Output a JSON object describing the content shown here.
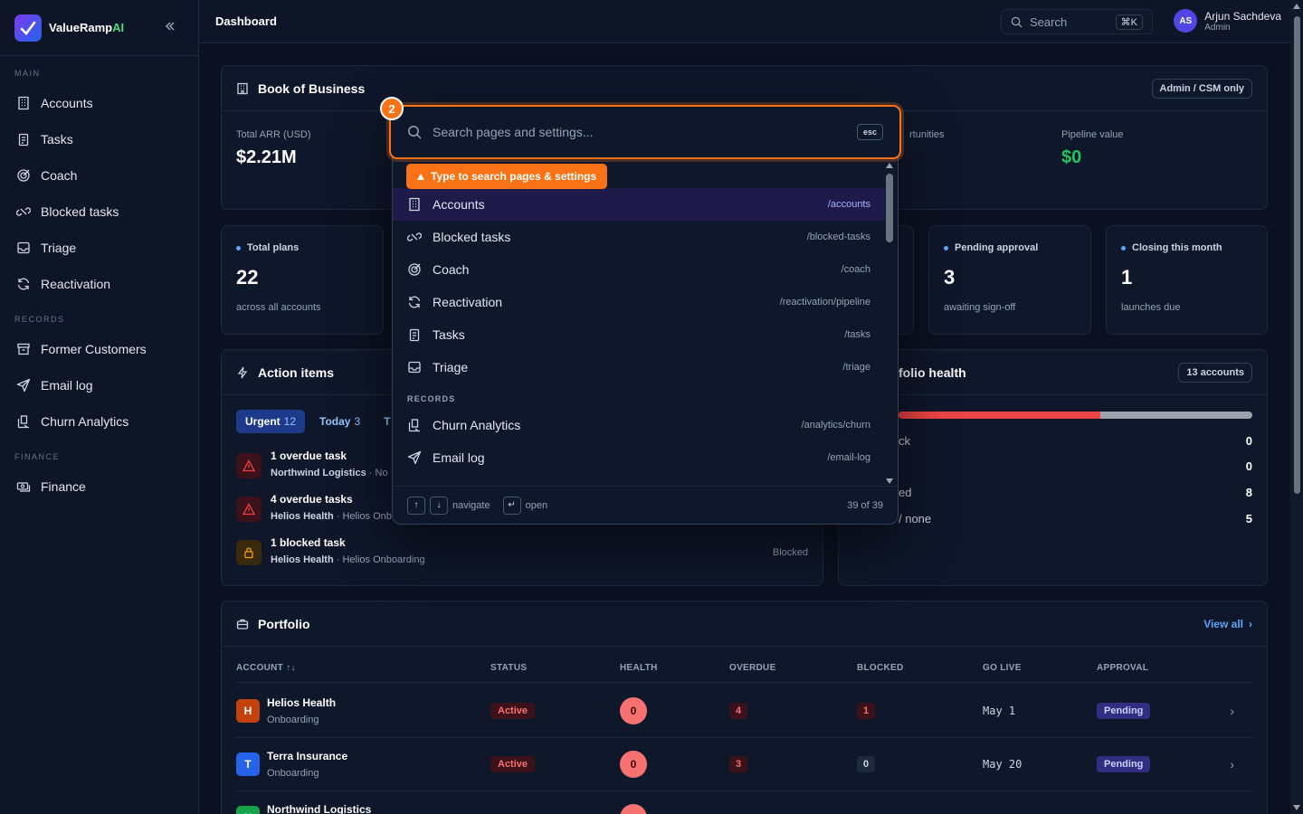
{
  "brand": {
    "name_main": "ValueRamp",
    "name_accent": "AI"
  },
  "sidebar": {
    "sections": [
      {
        "label": "MAIN",
        "items": [
          {
            "label": "Accounts",
            "icon": "building-icon"
          },
          {
            "label": "Tasks",
            "icon": "clipboard-icon"
          },
          {
            "label": "Coach",
            "icon": "target-icon"
          },
          {
            "label": "Blocked tasks",
            "icon": "link-broken-icon"
          },
          {
            "label": "Triage",
            "icon": "inbox-icon"
          },
          {
            "label": "Reactivation",
            "icon": "refresh-icon"
          }
        ]
      },
      {
        "label": "RECORDS",
        "items": [
          {
            "label": "Former Customers",
            "icon": "archive-icon"
          },
          {
            "label": "Email log",
            "icon": "send-icon"
          },
          {
            "label": "Churn Analytics",
            "icon": "chart-icon"
          }
        ]
      },
      {
        "label": "FINANCE",
        "items": [
          {
            "label": "Finance",
            "icon": "money-icon"
          }
        ]
      }
    ]
  },
  "header": {
    "title": "Dashboard",
    "search_label": "Search",
    "search_kbd": "⌘K",
    "user": {
      "initials": "AS",
      "name": "Arjun Sachdeva",
      "role": "Admin"
    }
  },
  "book": {
    "title": "Book of Business",
    "badge": "Admin / CSM only",
    "metrics": [
      {
        "label": "Total ARR (USD)",
        "value": "$2.21M"
      },
      {
        "label": "rtunities",
        "value": ""
      },
      {
        "label": "Pipeline value",
        "value": "$0"
      }
    ]
  },
  "stats": [
    {
      "label": "Total plans",
      "value": "22",
      "sub": "across all accounts"
    },
    {
      "label": "Pending approval",
      "value": "3",
      "sub": "awaiting sign-off"
    },
    {
      "label": "Closing this month",
      "value": "1",
      "sub": "launches due"
    }
  ],
  "actions": {
    "title": "Action items",
    "tabs": [
      {
        "label": "Urgent",
        "count": "12"
      },
      {
        "label": "Today",
        "count": "3"
      },
      {
        "label": "T",
        "count": ""
      }
    ],
    "items": [
      {
        "title": "1 overdue task",
        "account": "Northwind Logistics",
        "rest": " · No",
        "status": ""
      },
      {
        "title": "4 overdue tasks",
        "account": "Helios Health",
        "rest": " · Helios Onb",
        "status": ""
      },
      {
        "title": "1 blocked task",
        "account": "Helios Health",
        "rest": " · Helios Onboarding",
        "status": "Blocked"
      }
    ]
  },
  "health": {
    "title": "folio health",
    "badge": "13 accounts",
    "red_fraction": 0.57,
    "rows": [
      {
        "label": "ck",
        "value": "0"
      },
      {
        "label": "",
        "value": "0"
      },
      {
        "label": "ed",
        "value": "8"
      },
      {
        "label": "/ none",
        "value": "5"
      }
    ]
  },
  "portfolio": {
    "title": "Portfolio",
    "view_all": "View all",
    "columns": [
      "ACCOUNT",
      "STATUS",
      "HEALTH",
      "OVERDUE",
      "BLOCKED",
      "GO LIVE",
      "APPROVAL"
    ],
    "sort_icon": "↑↓",
    "rows": [
      {
        "initial": "H",
        "color": "#c2410c",
        "name": "Helios Health",
        "stage": "Onboarding",
        "status": "Active",
        "health": "0",
        "overdue": "4",
        "blocked": "1",
        "golive": "May 1",
        "approval": "Pending"
      },
      {
        "initial": "T",
        "color": "#2563eb",
        "name": "Terra Insurance",
        "stage": "Onboarding",
        "status": "Active",
        "health": "0",
        "overdue": "3",
        "blocked": "0",
        "golive": "May 20",
        "approval": "Pending"
      },
      {
        "initial": "N",
        "color": "#16a34a",
        "name": "Northwind Logistics",
        "stage": "",
        "status": "",
        "health": "",
        "overdue": "",
        "blocked": "",
        "golive": "",
        "approval": ""
      }
    ]
  },
  "palette": {
    "marker": "2",
    "placeholder": "Search pages and settings...",
    "esc": "esc",
    "hint": "Type to search pages & settings",
    "items": [
      {
        "label": "Accounts",
        "path": "/accounts",
        "icon": "building-icon"
      },
      {
        "label": "Blocked tasks",
        "path": "/blocked-tasks",
        "icon": "link-broken-icon"
      },
      {
        "label": "Coach",
        "path": "/coach",
        "icon": "target-icon"
      },
      {
        "label": "Reactivation",
        "path": "/reactivation/pipeline",
        "icon": "refresh-icon"
      },
      {
        "label": "Tasks",
        "path": "/tasks",
        "icon": "clipboard-icon"
      },
      {
        "label": "Triage",
        "path": "/triage",
        "icon": "inbox-icon"
      }
    ],
    "section_records": "RECORDS",
    "records": [
      {
        "label": "Churn Analytics",
        "path": "/analytics/churn",
        "icon": "chart-icon"
      },
      {
        "label": "Email log",
        "path": "/email-log",
        "icon": "send-icon"
      }
    ],
    "footer": {
      "navigate": "navigate",
      "open": "open",
      "count": "39 of 39"
    }
  }
}
